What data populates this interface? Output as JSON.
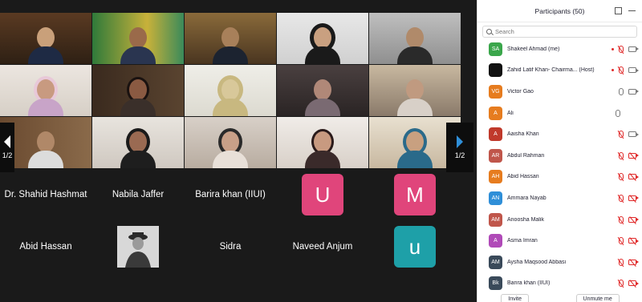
{
  "panel": {
    "title": "Participants (50)",
    "search_placeholder": "Search",
    "invite_label": "Invite",
    "unmute_label": "Unmute me"
  },
  "participants": [
    {
      "initials": "SA",
      "name": "Shakeel Ahmad (me)",
      "color": "#3aa64b",
      "rec": true,
      "mic": "muted",
      "cam": "on"
    },
    {
      "initials": "",
      "name": "Zahid Latif Khan- Chairma... (Host)",
      "color": "#111111",
      "rec": true,
      "mic": "muted",
      "cam": "on"
    },
    {
      "initials": "VG",
      "name": "Victor Gao",
      "color": "#e67c1f",
      "rec": false,
      "mic": "on",
      "cam": "on"
    },
    {
      "initials": "A",
      "name": "Ali",
      "color": "#e67c1f",
      "rec": false,
      "mic": "on",
      "cam": "none"
    },
    {
      "initials": "A",
      "name": "Aaisha Khan",
      "color": "#c0392b",
      "rec": false,
      "mic": "muted",
      "cam": "on"
    },
    {
      "initials": "AR",
      "name": "Abdul Rahman",
      "color": "#c0564b",
      "rec": false,
      "mic": "muted",
      "cam": "muted"
    },
    {
      "initials": "AH",
      "name": "Abid Hassan",
      "color": "#e67c1f",
      "rec": false,
      "mic": "muted",
      "cam": "muted"
    },
    {
      "initials": "AN",
      "name": "Ammara Nayab",
      "color": "#2f8fd8",
      "rec": false,
      "mic": "muted",
      "cam": "muted"
    },
    {
      "initials": "AM",
      "name": "Anoosha Malik",
      "color": "#c0564b",
      "rec": false,
      "mic": "muted",
      "cam": "muted"
    },
    {
      "initials": "A",
      "name": "Asma Imran",
      "color": "#b04ab8",
      "rec": false,
      "mic": "muted",
      "cam": "muted"
    },
    {
      "initials": "AM",
      "name": "Aysha Maqsood Abbasi",
      "color": "#3a4a5a",
      "rec": false,
      "mic": "muted",
      "cam": "muted"
    },
    {
      "initials": "Bk",
      "name": "Barira khan (IIUI)",
      "color": "#3a4a5a",
      "rec": false,
      "mic": "muted",
      "cam": "muted"
    }
  ],
  "gallery": {
    "page_left": "1/2",
    "page_right": "1/2",
    "name_tiles": [
      {
        "name": "Dr. Shahid Hashmat"
      },
      {
        "name": "Nabila Jaffer"
      },
      {
        "name": "Barira khan (IIUI)"
      },
      {
        "name": "Abid Hassan"
      },
      {
        "name": "Sidra"
      },
      {
        "name": "Naveed Anjum"
      }
    ],
    "letter_tiles": [
      {
        "letter": "U",
        "color": "#e0457b"
      },
      {
        "letter": "M",
        "color": "#e0457b"
      },
      {
        "letter": "u",
        "color": "#1ea0a8"
      }
    ]
  }
}
